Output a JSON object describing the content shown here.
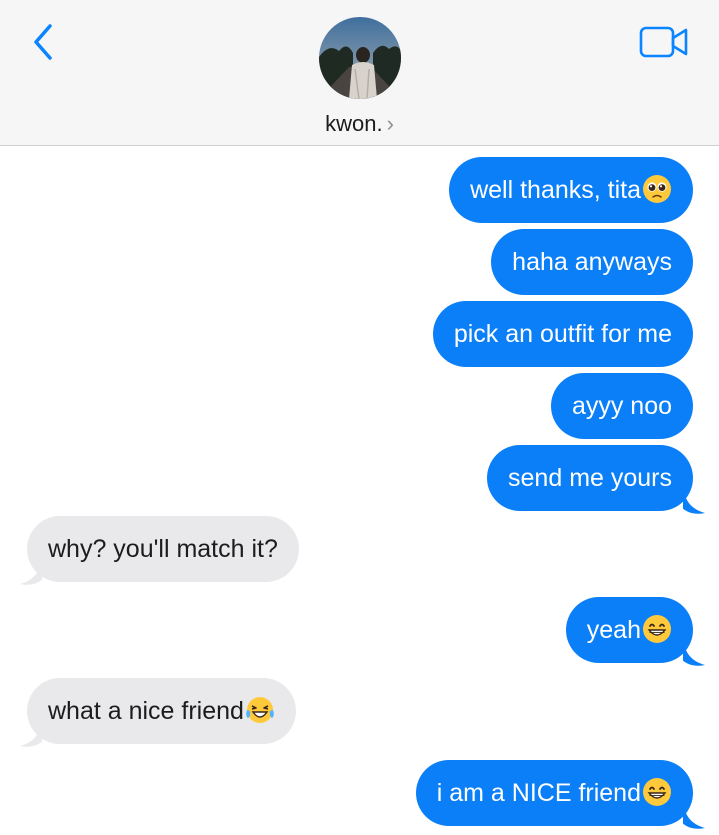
{
  "header": {
    "contact_name": "kwon.",
    "chevron": "›",
    "back_icon": "chevron-left-icon",
    "video_icon": "video-camera-icon"
  },
  "colors": {
    "outgoing": "#0b7ff7",
    "incoming": "#e9e9eb",
    "accent": "#0a84ff"
  },
  "messages": [
    {
      "from": "me",
      "text": "well thanks, tita",
      "emoji": "pleading-face"
    },
    {
      "from": "me",
      "text": "haha anyways"
    },
    {
      "from": "me",
      "text": "pick an outfit for me"
    },
    {
      "from": "me",
      "text": "ayyy noo"
    },
    {
      "from": "me",
      "text": "send me yours"
    },
    {
      "from": "them",
      "text": "why? you'll match it?"
    },
    {
      "from": "me",
      "text": "yeah",
      "emoji": "grinning-face"
    },
    {
      "from": "them",
      "text": "what a nice friend",
      "emoji": "tears-of-joy-face"
    },
    {
      "from": "me",
      "text": "i am a NICE friend",
      "emoji": "grinning-face"
    }
  ]
}
